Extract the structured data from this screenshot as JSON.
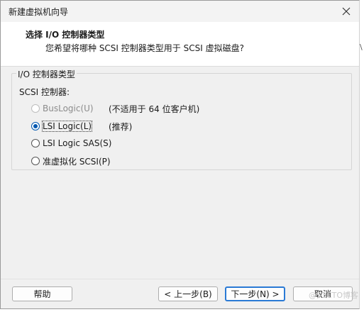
{
  "window": {
    "title": "新建虚拟机向导"
  },
  "header": {
    "title": "选择 I/O 控制器类型",
    "subtitle": "您希望将哪种 SCSI 控制器类型用于 SCSI 虚拟磁盘?"
  },
  "group": {
    "label": "I/O 控制器类型",
    "scsi_label": "SCSI 控制器:",
    "options": [
      {
        "label": "BusLogic(U)",
        "note": "(不适用于 64 位客户机)",
        "checked": false,
        "disabled": true
      },
      {
        "label": "LSI Logic(L)",
        "note": "(推荐)",
        "checked": true,
        "disabled": false
      },
      {
        "label": "LSI Logic SAS(S)",
        "note": "",
        "checked": false,
        "disabled": false
      },
      {
        "label": "准虚拟化 SCSI(P)",
        "note": "",
        "checked": false,
        "disabled": false
      }
    ]
  },
  "buttons": {
    "help": "帮助",
    "back": "< 上一步(B)",
    "next": "下一步(N) >",
    "cancel": "取消"
  },
  "watermark": "@51CTO博客",
  "edge_glyph": "\\"
}
